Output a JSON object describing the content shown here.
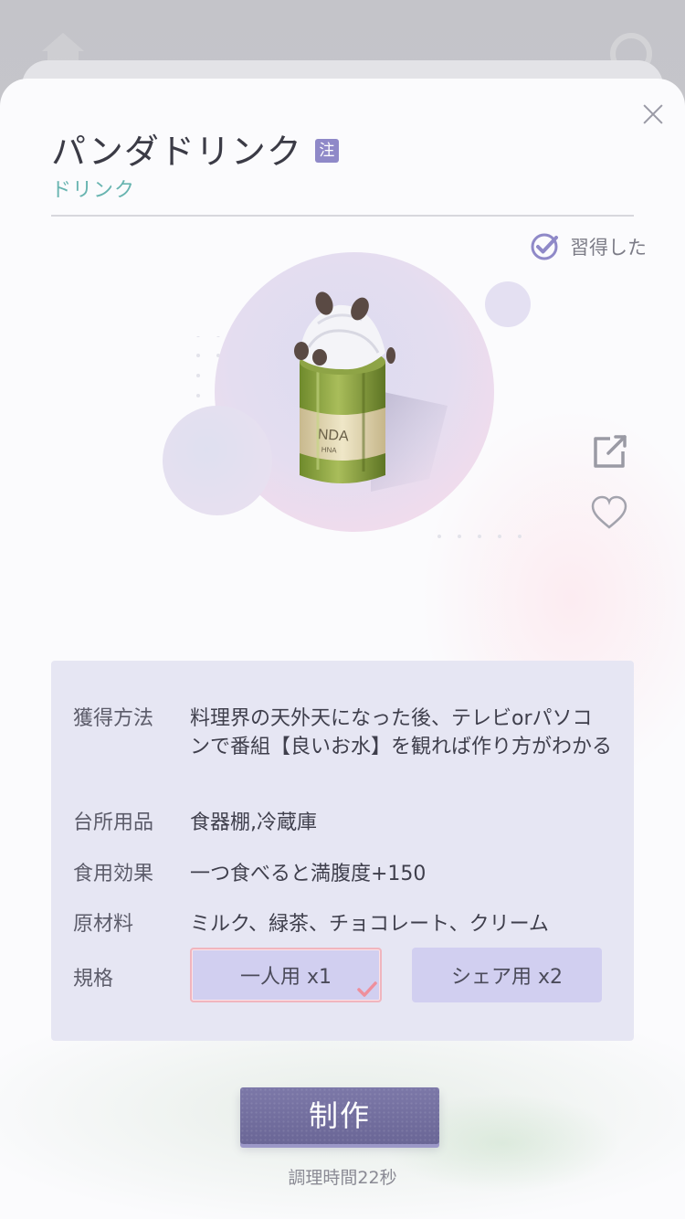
{
  "dialog": {
    "title": "パンダドリンク",
    "note_badge": "注",
    "category": "ドリンク",
    "learned_status": "習得した"
  },
  "info": {
    "rows": [
      {
        "label": "獲得方法",
        "value": "料理界の天外天になった後、テレビorパソコンで番組【良いお水】を観れば作り方がわかる"
      },
      {
        "label": "台所用品",
        "value": "食器棚,冷蔵庫"
      },
      {
        "label": "食用効果",
        "value": "一つ食べると満腹度+150"
      },
      {
        "label": "原材料",
        "value": "ミルク、緑茶、チョコレート、クリーム"
      }
    ],
    "spec": {
      "label": "規格",
      "options": [
        {
          "label": "一人用 x1",
          "selected": true
        },
        {
          "label": "シェア用 x2",
          "selected": false
        }
      ]
    }
  },
  "actions": {
    "make_label": "制作",
    "cook_time": "調理時間22秒"
  },
  "colors": {
    "accent": "#8f89c8",
    "category": "#67b4b0",
    "button": "#726e9e",
    "panel": "#e6e6f3"
  },
  "icons": [
    "close-icon",
    "checkmark-circle-icon",
    "share-icon",
    "heart-icon",
    "check-icon"
  ]
}
